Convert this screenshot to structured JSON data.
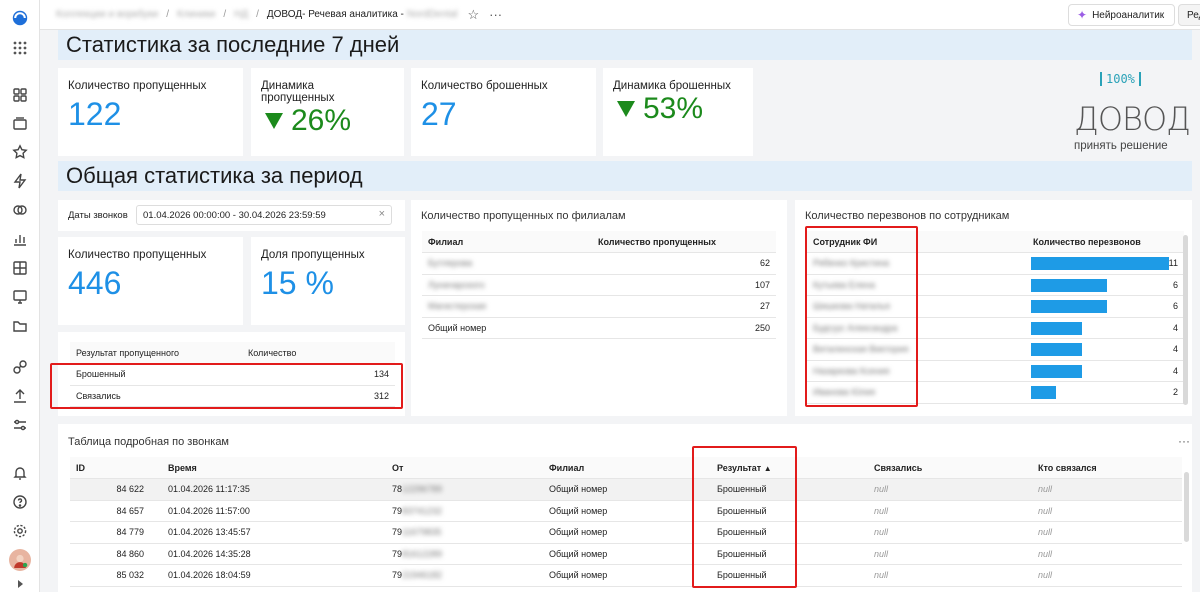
{
  "topbar": {
    "crumbs": [
      "Коллекции и воркбуки",
      "Клиники",
      "НД"
    ],
    "current": "ДОВОД- Речевая аналитика - ",
    "current_blurred": "NordDental",
    "ai_button": "Нейроаналитик",
    "edit_button": "Редактировать"
  },
  "section1": {
    "title": "Статистика за последние 7 дней"
  },
  "section2": {
    "title": "Общая статистика за период"
  },
  "kpi_week": {
    "missed": {
      "label": "Количество пропущенных",
      "value": "122"
    },
    "missed_dyn": {
      "label": "Динамика пропущенных",
      "value": "26%"
    },
    "abandoned": {
      "label": "Количество брошенных",
      "value": "27"
    },
    "abandoned_dyn": {
      "label": "Динамика брошенных",
      "value": "53%"
    }
  },
  "logo": {
    "badge": "100%",
    "name": "ДОВОД",
    "tagline": "принять решение"
  },
  "date_filter": {
    "label": "Даты звонков",
    "value": "01.04.2026 00:00:00 - 30.04.2026 23:59:59"
  },
  "kpi_period": {
    "missed": {
      "label": "Количество пропущенных",
      "value": "446"
    },
    "share": {
      "label": "Доля пропущенных",
      "value": "15 %"
    }
  },
  "result_table": {
    "headers": [
      "Результат пропущенного",
      "Количество"
    ],
    "rows": [
      [
        "Брошенный",
        "134"
      ],
      [
        "Связались",
        "312"
      ]
    ]
  },
  "branch_table": {
    "title": "Количество пропущенных по филиалам",
    "headers": [
      "Филиал",
      "Количество пропущенных"
    ],
    "rows": [
      [
        "Бутлерова",
        "62"
      ],
      [
        "Луначарского",
        "107"
      ],
      [
        "Магистерская",
        "27"
      ],
      [
        "Общий номер",
        "250"
      ]
    ]
  },
  "callback_table": {
    "title": "Количество перезвонов по сотрудникам",
    "headers": [
      "Сотрудник ФИ",
      "Количество перезвонов"
    ],
    "rows": [
      {
        "name": "Рябенко Кристина",
        "value": 11
      },
      {
        "name": "Кутьева Елена",
        "value": 6
      },
      {
        "name": "Шишкова Наталья",
        "value": 6
      },
      {
        "name": "Будгуус Александра",
        "value": 4
      },
      {
        "name": "Виталинская Виктория",
        "value": 4
      },
      {
        "name": "Назаркова Ксения",
        "value": 4
      },
      {
        "name": "Иванова Юлия",
        "value": 2
      }
    ],
    "max": 11
  },
  "detail_table": {
    "title": "Таблица подробная по звонкам",
    "headers": [
      "ID",
      "Время",
      "От",
      "Филиал",
      "Результат",
      "Связались",
      "Кто связался"
    ],
    "rows": [
      [
        "84 622",
        "01.04.2026 11:17:35",
        "78",
        "12296789",
        "Общий номер",
        "Брошенный",
        "null",
        "null"
      ],
      [
        "84 657",
        "01.04.2026 11:57:00",
        "79",
        "83741232",
        "Общий номер",
        "Брошенный",
        "null",
        "null"
      ],
      [
        "84 779",
        "01.04.2026 13:45:57",
        "79",
        "11679835",
        "Общий номер",
        "Брошенный",
        "null",
        "null"
      ],
      [
        "84 860",
        "01.04.2026 14:35:28",
        "79",
        "81612289",
        "Общий номер",
        "Брошенный",
        "null",
        "null"
      ],
      [
        "85 032",
        "01.04.2026 18:04:59",
        "79",
        "21946182",
        "Общий номер",
        "Брошенный",
        "null",
        "null"
      ]
    ]
  },
  "colors": {
    "accent": "#1e90e6",
    "green": "#1c8a1c",
    "highlight": "#e21b1b",
    "section_bg": "#e2eef9"
  }
}
